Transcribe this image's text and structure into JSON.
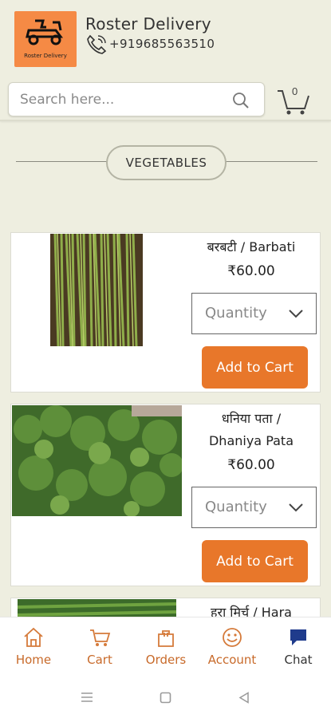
{
  "header": {
    "logo_text": "Roster Delivery",
    "brand_name": "Roster Delivery",
    "phone": "+919685563510"
  },
  "search": {
    "placeholder": "Search here...",
    "cart_count": "0"
  },
  "section": {
    "title": "VEGETABLES"
  },
  "products": [
    {
      "name_line1": "बरबटी / Barbati",
      "name_line2": "",
      "price": "₹60.00",
      "quantity_placeholder": "Quantity",
      "button_label": "Add to Cart"
    },
    {
      "name_line1": "धनिया पता /",
      "name_line2": "Dhaniya Pata",
      "price": "₹60.00",
      "quantity_placeholder": "Quantity",
      "button_label": "Add to Cart"
    },
    {
      "name_line1": "हरा मिर्च / Hara",
      "name_line2": "",
      "price": "",
      "quantity_placeholder": "",
      "button_label": ""
    }
  ],
  "bottom_nav": {
    "items": [
      {
        "label": "Home",
        "icon": "home-icon"
      },
      {
        "label": "Cart",
        "icon": "cart-icon"
      },
      {
        "label": "Orders",
        "icon": "bag-icon"
      },
      {
        "label": "Account",
        "icon": "smiley-icon"
      },
      {
        "label": "Chat",
        "icon": "chat-icon"
      }
    ]
  },
  "colors": {
    "background": "#eeeee0",
    "accent": "#e8772a",
    "logo_bg": "#f58a45",
    "nav_active": "#c86a2a",
    "chat_icon": "#1f3b8c"
  }
}
